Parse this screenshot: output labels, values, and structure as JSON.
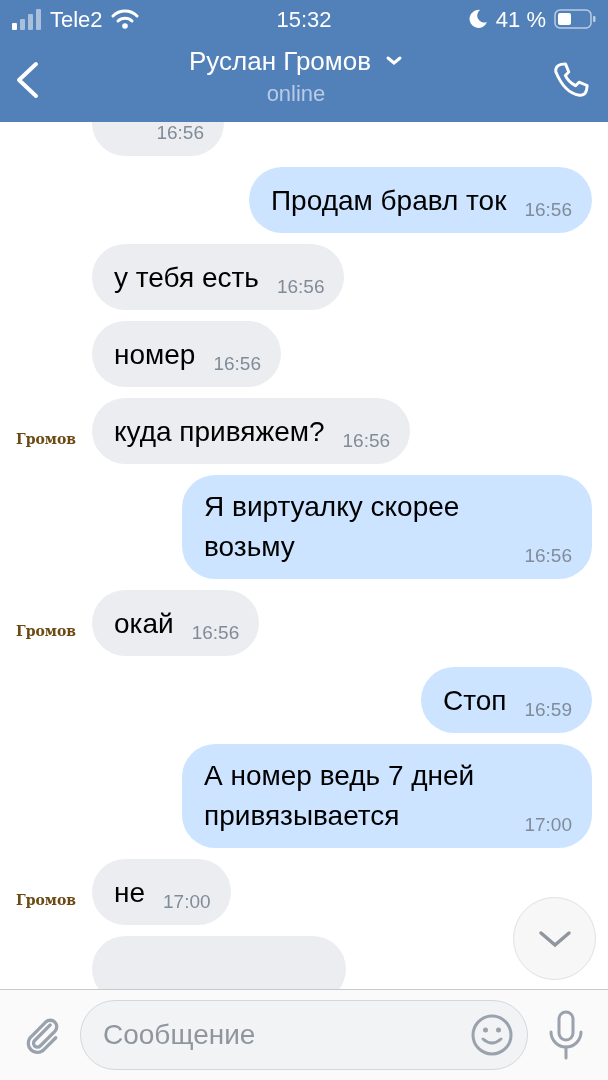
{
  "status_bar": {
    "carrier": "Tele2",
    "time": "15:32",
    "battery": "41 %"
  },
  "header": {
    "title": "Руслан Громов",
    "subtitle": "online"
  },
  "messages": [
    {
      "kind": "text",
      "outgoing": false,
      "time": "16:56"
    },
    {
      "kind": "text",
      "outgoing": true,
      "text": "Продам бравл ток",
      "time": "16:56"
    },
    {
      "kind": "text",
      "outgoing": false,
      "text": "у тебя есть",
      "time": "16:56"
    },
    {
      "kind": "text",
      "outgoing": false,
      "text": "номер",
      "time": "16:56"
    },
    {
      "kind": "text",
      "outgoing": false,
      "text": "куда привяжем?",
      "time": "16:56",
      "avatar_label": "Громов"
    },
    {
      "kind": "text",
      "outgoing": true,
      "text": "Я виртуалку скорее возьму",
      "time": "16:56"
    },
    {
      "kind": "text",
      "outgoing": false,
      "text": "окай",
      "time": "16:56",
      "avatar_label": "Громов"
    },
    {
      "kind": "text",
      "outgoing": true,
      "text": "Стоп",
      "time": "16:59"
    },
    {
      "kind": "text",
      "outgoing": true,
      "text": "А номер ведь 7 дней привязывается",
      "time": "17:00"
    },
    {
      "kind": "text",
      "outgoing": false,
      "text": "не",
      "time": "17:00",
      "avatar_label": "Громов"
    },
    {
      "kind": "stub",
      "outgoing": false
    }
  ],
  "composer": {
    "placeholder": "Сообщение"
  }
}
